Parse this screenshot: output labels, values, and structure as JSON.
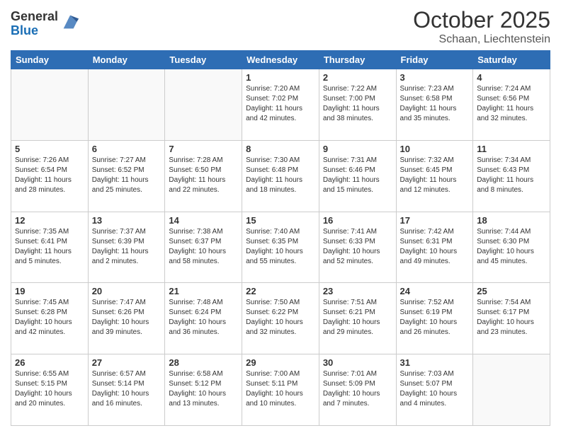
{
  "logo": {
    "general": "General",
    "blue": "Blue"
  },
  "header": {
    "title": "October 2025",
    "subtitle": "Schaan, Liechtenstein"
  },
  "weekdays": [
    "Sunday",
    "Monday",
    "Tuesday",
    "Wednesday",
    "Thursday",
    "Friday",
    "Saturday"
  ],
  "weeks": [
    [
      {
        "day": "",
        "info": ""
      },
      {
        "day": "",
        "info": ""
      },
      {
        "day": "",
        "info": ""
      },
      {
        "day": "1",
        "info": "Sunrise: 7:20 AM\nSunset: 7:02 PM\nDaylight: 11 hours\nand 42 minutes."
      },
      {
        "day": "2",
        "info": "Sunrise: 7:22 AM\nSunset: 7:00 PM\nDaylight: 11 hours\nand 38 minutes."
      },
      {
        "day": "3",
        "info": "Sunrise: 7:23 AM\nSunset: 6:58 PM\nDaylight: 11 hours\nand 35 minutes."
      },
      {
        "day": "4",
        "info": "Sunrise: 7:24 AM\nSunset: 6:56 PM\nDaylight: 11 hours\nand 32 minutes."
      }
    ],
    [
      {
        "day": "5",
        "info": "Sunrise: 7:26 AM\nSunset: 6:54 PM\nDaylight: 11 hours\nand 28 minutes."
      },
      {
        "day": "6",
        "info": "Sunrise: 7:27 AM\nSunset: 6:52 PM\nDaylight: 11 hours\nand 25 minutes."
      },
      {
        "day": "7",
        "info": "Sunrise: 7:28 AM\nSunset: 6:50 PM\nDaylight: 11 hours\nand 22 minutes."
      },
      {
        "day": "8",
        "info": "Sunrise: 7:30 AM\nSunset: 6:48 PM\nDaylight: 11 hours\nand 18 minutes."
      },
      {
        "day": "9",
        "info": "Sunrise: 7:31 AM\nSunset: 6:46 PM\nDaylight: 11 hours\nand 15 minutes."
      },
      {
        "day": "10",
        "info": "Sunrise: 7:32 AM\nSunset: 6:45 PM\nDaylight: 11 hours\nand 12 minutes."
      },
      {
        "day": "11",
        "info": "Sunrise: 7:34 AM\nSunset: 6:43 PM\nDaylight: 11 hours\nand 8 minutes."
      }
    ],
    [
      {
        "day": "12",
        "info": "Sunrise: 7:35 AM\nSunset: 6:41 PM\nDaylight: 11 hours\nand 5 minutes."
      },
      {
        "day": "13",
        "info": "Sunrise: 7:37 AM\nSunset: 6:39 PM\nDaylight: 11 hours\nand 2 minutes."
      },
      {
        "day": "14",
        "info": "Sunrise: 7:38 AM\nSunset: 6:37 PM\nDaylight: 10 hours\nand 58 minutes."
      },
      {
        "day": "15",
        "info": "Sunrise: 7:40 AM\nSunset: 6:35 PM\nDaylight: 10 hours\nand 55 minutes."
      },
      {
        "day": "16",
        "info": "Sunrise: 7:41 AM\nSunset: 6:33 PM\nDaylight: 10 hours\nand 52 minutes."
      },
      {
        "day": "17",
        "info": "Sunrise: 7:42 AM\nSunset: 6:31 PM\nDaylight: 10 hours\nand 49 minutes."
      },
      {
        "day": "18",
        "info": "Sunrise: 7:44 AM\nSunset: 6:30 PM\nDaylight: 10 hours\nand 45 minutes."
      }
    ],
    [
      {
        "day": "19",
        "info": "Sunrise: 7:45 AM\nSunset: 6:28 PM\nDaylight: 10 hours\nand 42 minutes."
      },
      {
        "day": "20",
        "info": "Sunrise: 7:47 AM\nSunset: 6:26 PM\nDaylight: 10 hours\nand 39 minutes."
      },
      {
        "day": "21",
        "info": "Sunrise: 7:48 AM\nSunset: 6:24 PM\nDaylight: 10 hours\nand 36 minutes."
      },
      {
        "day": "22",
        "info": "Sunrise: 7:50 AM\nSunset: 6:22 PM\nDaylight: 10 hours\nand 32 minutes."
      },
      {
        "day": "23",
        "info": "Sunrise: 7:51 AM\nSunset: 6:21 PM\nDaylight: 10 hours\nand 29 minutes."
      },
      {
        "day": "24",
        "info": "Sunrise: 7:52 AM\nSunset: 6:19 PM\nDaylight: 10 hours\nand 26 minutes."
      },
      {
        "day": "25",
        "info": "Sunrise: 7:54 AM\nSunset: 6:17 PM\nDaylight: 10 hours\nand 23 minutes."
      }
    ],
    [
      {
        "day": "26",
        "info": "Sunrise: 6:55 AM\nSunset: 5:15 PM\nDaylight: 10 hours\nand 20 minutes."
      },
      {
        "day": "27",
        "info": "Sunrise: 6:57 AM\nSunset: 5:14 PM\nDaylight: 10 hours\nand 16 minutes."
      },
      {
        "day": "28",
        "info": "Sunrise: 6:58 AM\nSunset: 5:12 PM\nDaylight: 10 hours\nand 13 minutes."
      },
      {
        "day": "29",
        "info": "Sunrise: 7:00 AM\nSunset: 5:11 PM\nDaylight: 10 hours\nand 10 minutes."
      },
      {
        "day": "30",
        "info": "Sunrise: 7:01 AM\nSunset: 5:09 PM\nDaylight: 10 hours\nand 7 minutes."
      },
      {
        "day": "31",
        "info": "Sunrise: 7:03 AM\nSunset: 5:07 PM\nDaylight: 10 hours\nand 4 minutes."
      },
      {
        "day": "",
        "info": ""
      }
    ]
  ]
}
